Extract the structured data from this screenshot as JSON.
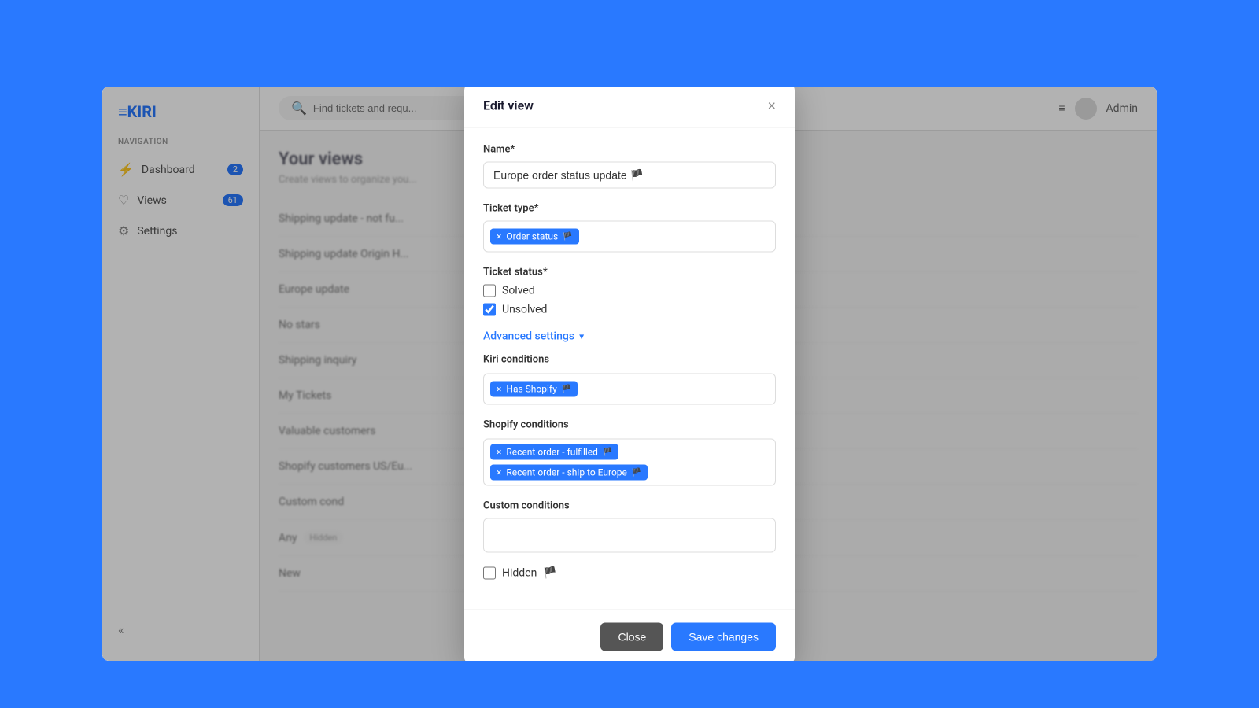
{
  "app": {
    "logo": "≡KIRI",
    "background_color": "#2979ff"
  },
  "sidebar": {
    "nav_label": "NAVIGATION",
    "items": [
      {
        "id": "dashboard",
        "label": "Dashboard",
        "icon": "dashboard-icon",
        "badge": "2",
        "badge_color": "blue"
      },
      {
        "id": "views",
        "label": "Views",
        "icon": "views-icon",
        "badge": "61",
        "badge_color": "blue"
      },
      {
        "id": "settings",
        "label": "Settings",
        "icon": "settings-icon",
        "badge": null
      }
    ],
    "collapse_label": "«"
  },
  "topbar": {
    "search_placeholder": "Find tickets and requ...",
    "admin_label": "Admin"
  },
  "views_page": {
    "title": "Your views",
    "subtitle": "Create views to organize you...",
    "items": [
      {
        "label": "Shipping update - not fu...",
        "hidden": false
      },
      {
        "label": "Shipping update Origin H...",
        "hidden": false
      },
      {
        "label": "Europe update",
        "hidden": false
      },
      {
        "label": "No stars",
        "hidden": false
      },
      {
        "label": "Shipping inquiry",
        "hidden": false
      },
      {
        "label": "My Tickets",
        "hidden": false
      },
      {
        "label": "Valuable customers",
        "hidden": false
      },
      {
        "label": "Shopify customers US/Eu...",
        "hidden": false
      },
      {
        "label": "Custom cond",
        "hidden": false
      },
      {
        "label": "Any",
        "hidden": true
      },
      {
        "label": "New",
        "hidden": false
      }
    ]
  },
  "modal": {
    "title": "Edit view",
    "close_label": "×",
    "name_label": "Name*",
    "name_value": "Europe order status update 🏴",
    "ticket_type_label": "Ticket type*",
    "ticket_type_tags": [
      {
        "label": "Order status",
        "icon": "🏴"
      }
    ],
    "ticket_status_label": "Ticket status*",
    "ticket_status_options": [
      {
        "label": "Solved",
        "checked": false
      },
      {
        "label": "Unsolved",
        "checked": true
      }
    ],
    "advanced_settings_label": "Advanced settings",
    "kiri_conditions_label": "Kiri conditions",
    "kiri_conditions_tags": [
      {
        "label": "Has Shopify",
        "icon": "🏴"
      }
    ],
    "shopify_conditions_label": "Shopify conditions",
    "shopify_conditions_tags": [
      {
        "label": "Recent order - fulfilled",
        "icon": "🏴"
      },
      {
        "label": "Recent order - ship to Europe",
        "icon": "🏴"
      }
    ],
    "custom_conditions_label": "Custom conditions",
    "custom_conditions_value": "",
    "hidden_label": "Hidden",
    "hidden_checked": false,
    "hidden_icon": "🏴",
    "footer": {
      "close_label": "Close",
      "save_label": "Save changes"
    }
  }
}
